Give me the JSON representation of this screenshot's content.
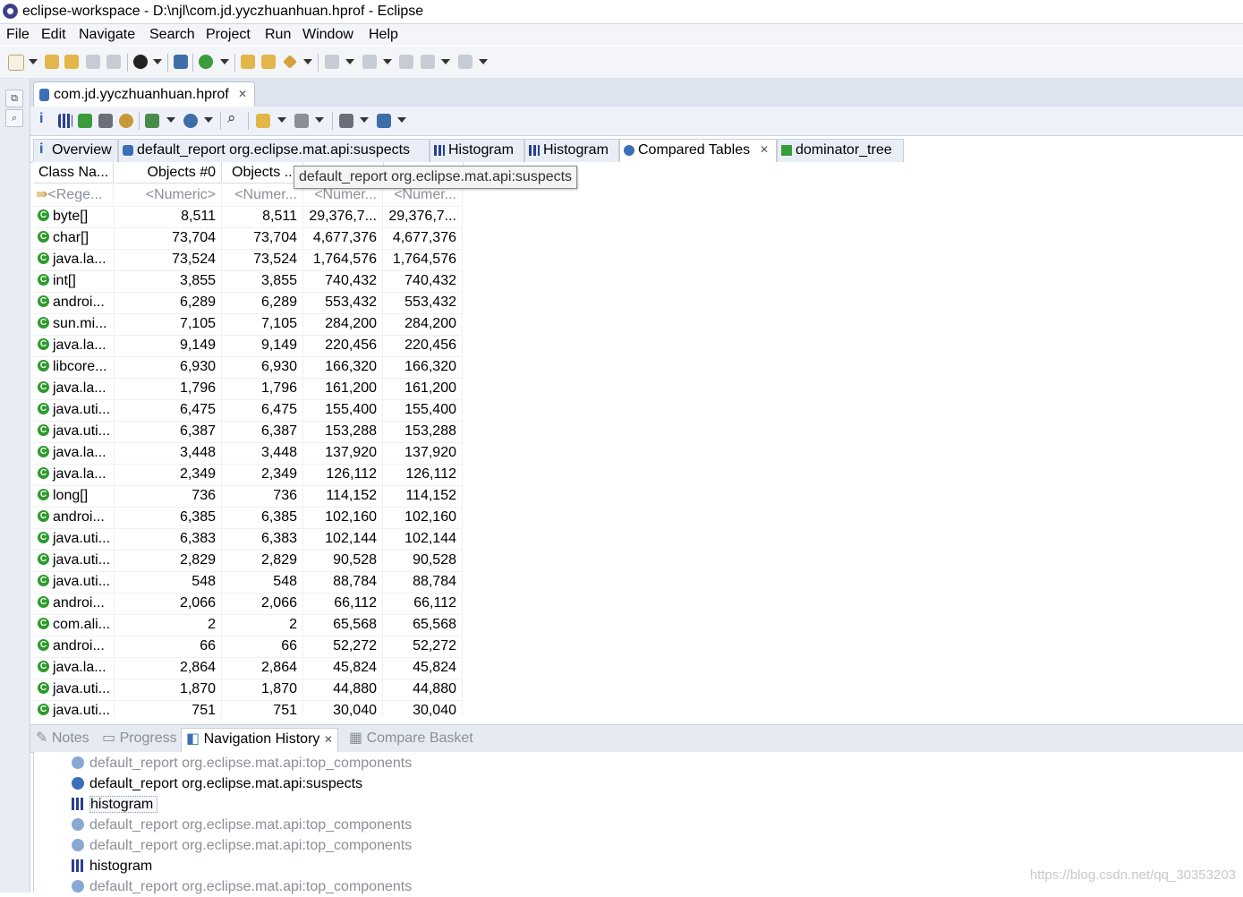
{
  "window": {
    "title": "eclipse-workspace - D:\\njl\\com.jd.yyczhuanhuan.hprof - Eclipse"
  },
  "menu": [
    "File",
    "Edit",
    "Navigate",
    "Search",
    "Project",
    "Run",
    "Window",
    "Help"
  ],
  "editor": {
    "tab_label": "com.jd.yyczhuanhuan.hprof"
  },
  "result_tabs": [
    {
      "label": "Overview",
      "icon": "info-icon"
    },
    {
      "label": "default_report  org.eclipse.mat.api:suspects",
      "icon": "report-icon"
    },
    {
      "label": "Histogram",
      "icon": "histogram-icon"
    },
    {
      "label": "Histogram",
      "icon": "histogram-icon"
    },
    {
      "label": "Compared Tables",
      "icon": "compare-icon",
      "active": true
    },
    {
      "label": "dominator_tree",
      "icon": "tree-icon"
    }
  ],
  "table": {
    "headers": [
      "Class Na...",
      "Objects #0",
      "Objects ..."
    ],
    "filters": [
      "<Rege...",
      "<Numeric>",
      "<Numer...",
      "<Numer...",
      "<Numer..."
    ],
    "tooltip": "default_report  org.eclipse.mat.api:suspects",
    "rows": [
      [
        "byte[]",
        "8,511",
        "8,511",
        "29,376,7...",
        "29,376,7..."
      ],
      [
        "char[]",
        "73,704",
        "73,704",
        "4,677,376",
        "4,677,376"
      ],
      [
        "java.la...",
        "73,524",
        "73,524",
        "1,764,576",
        "1,764,576"
      ],
      [
        "int[]",
        "3,855",
        "3,855",
        "740,432",
        "740,432"
      ],
      [
        "androi...",
        "6,289",
        "6,289",
        "553,432",
        "553,432"
      ],
      [
        "sun.mi...",
        "7,105",
        "7,105",
        "284,200",
        "284,200"
      ],
      [
        "java.la...",
        "9,149",
        "9,149",
        "220,456",
        "220,456"
      ],
      [
        "libcore...",
        "6,930",
        "6,930",
        "166,320",
        "166,320"
      ],
      [
        "java.la...",
        "1,796",
        "1,796",
        "161,200",
        "161,200"
      ],
      [
        "java.uti...",
        "6,475",
        "6,475",
        "155,400",
        "155,400"
      ],
      [
        "java.uti...",
        "6,387",
        "6,387",
        "153,288",
        "153,288"
      ],
      [
        "java.la...",
        "3,448",
        "3,448",
        "137,920",
        "137,920"
      ],
      [
        "java.la...",
        "2,349",
        "2,349",
        "126,112",
        "126,112"
      ],
      [
        "long[]",
        "736",
        "736",
        "114,152",
        "114,152"
      ],
      [
        "androi...",
        "6,385",
        "6,385",
        "102,160",
        "102,160"
      ],
      [
        "java.uti...",
        "6,383",
        "6,383",
        "102,144",
        "102,144"
      ],
      [
        "java.uti...",
        "2,829",
        "2,829",
        "90,528",
        "90,528"
      ],
      [
        "java.uti...",
        "548",
        "548",
        "88,784",
        "88,784"
      ],
      [
        "androi...",
        "2,066",
        "2,066",
        "66,112",
        "66,112"
      ],
      [
        "com.ali...",
        "2",
        "2",
        "65,568",
        "65,568"
      ],
      [
        "androi...",
        "66",
        "66",
        "52,272",
        "52,272"
      ],
      [
        "java.la...",
        "2,864",
        "2,864",
        "45,824",
        "45,824"
      ],
      [
        "java.uti...",
        "1,870",
        "1,870",
        "44,880",
        "44,880"
      ],
      [
        "java.uti...",
        "751",
        "751",
        "30,040",
        "30,040"
      ]
    ]
  },
  "bottom_tabs": [
    {
      "label": "Notes",
      "icon": "notes-icon"
    },
    {
      "label": "Progress",
      "icon": "progress-icon"
    },
    {
      "label": "Navigation History",
      "icon": "history-icon",
      "active": true
    },
    {
      "label": "Compare Basket",
      "icon": "basket-icon"
    }
  ],
  "nav_history": [
    {
      "label": "default_report  org.eclipse.mat.api:top_components",
      "icon": "report-icon",
      "gray": true
    },
    {
      "label": "default_report  org.eclipse.mat.api:suspects",
      "icon": "report-icon",
      "gray": false
    },
    {
      "label": "histogram",
      "icon": "histogram-icon",
      "gray": false,
      "selected": true
    },
    {
      "label": "default_report  org.eclipse.mat.api:top_components",
      "icon": "report-icon",
      "gray": true
    },
    {
      "label": "default_report  org.eclipse.mat.api:top_components",
      "icon": "report-icon",
      "gray": true
    },
    {
      "label": "histogram",
      "icon": "histogram-icon",
      "gray": false
    },
    {
      "label": "default_report  org.eclipse.mat.api:top_components",
      "icon": "report-icon",
      "gray": true
    }
  ],
  "watermark": "https://blog.csdn.net/qq_30353203"
}
